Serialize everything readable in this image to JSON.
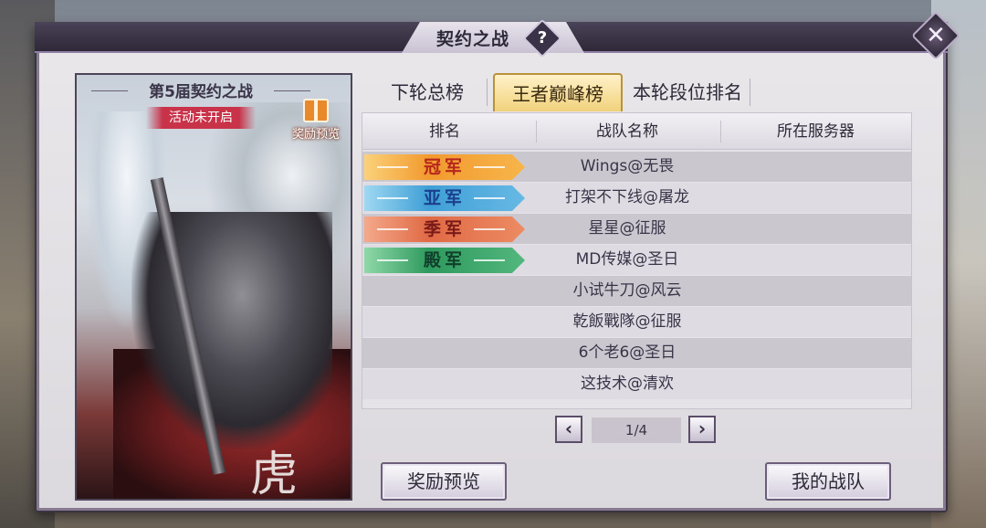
{
  "window": {
    "title": "契约之战",
    "help_label": "?",
    "close_label": "✕"
  },
  "event": {
    "season_title": "第5届契约之战",
    "status": "活动未开启",
    "reward_preview_label": "奖励预览",
    "art_glyph": "虎"
  },
  "tabs": [
    {
      "label": "下轮总榜",
      "active": false
    },
    {
      "label": "王者巅峰榜",
      "active": true
    },
    {
      "label": "本轮段位排名",
      "active": false
    }
  ],
  "table": {
    "headers": [
      "排名",
      "战队名称",
      "所在服务器"
    ],
    "rows": [
      {
        "rank": "冠军",
        "team": "Wings@无畏",
        "server": ""
      },
      {
        "rank": "亚军",
        "team": "打架不下线@屠龙",
        "server": ""
      },
      {
        "rank": "季军",
        "team": "星星@征服",
        "server": ""
      },
      {
        "rank": "殿军",
        "team": "MD传媒@圣日",
        "server": ""
      },
      {
        "rank": "",
        "team": "小试牛刀@风云",
        "server": ""
      },
      {
        "rank": "",
        "team": "乾飯戰隊@征服",
        "server": ""
      },
      {
        "rank": "",
        "team": "6个老6@圣日",
        "server": ""
      },
      {
        "rank": "",
        "team": "这技术@清欢",
        "server": ""
      }
    ]
  },
  "pagination": {
    "prev_label": "‹",
    "next_label": "›",
    "indicator": "1/4"
  },
  "buttons": {
    "reward_preview": "奖励预览",
    "my_team": "我的战队"
  },
  "colors": {
    "champion": "#f29a2e",
    "runner_up": "#3f9fd6",
    "third": "#e06a45",
    "fourth": "#2f9a5e",
    "accent_gold": "#f1d27b",
    "panel": "#e9e7ea"
  }
}
